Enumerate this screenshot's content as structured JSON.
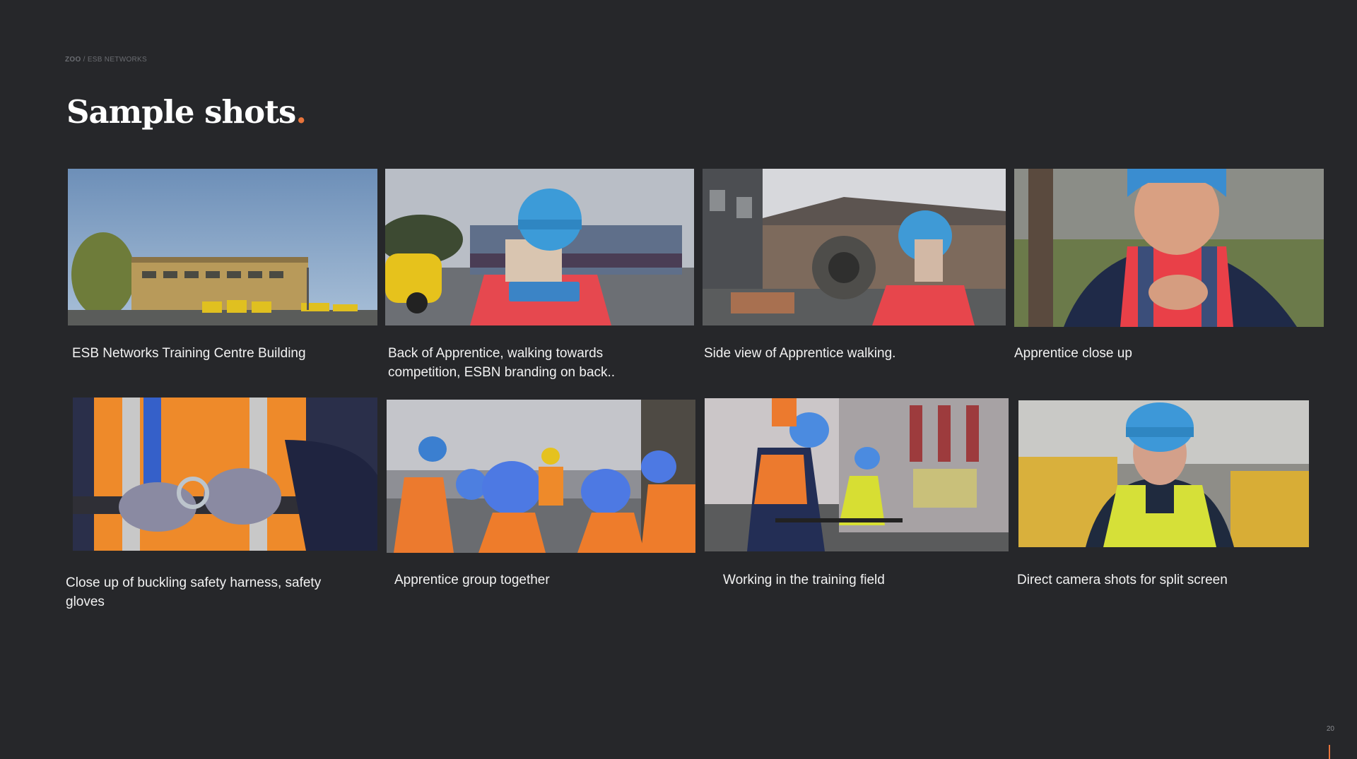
{
  "header": {
    "brand": "ZOO",
    "crumb_rest": " / ESB NETWORKS",
    "title": "Sample shots",
    "title_dot": "."
  },
  "shots": [
    {
      "caption": "ESB Networks Training Centre Building"
    },
    {
      "caption": "Back of Apprentice, walking towards competition, ESBN branding on back.."
    },
    {
      "caption": "Side view of Apprentice walking."
    },
    {
      "caption": "Apprentice close up"
    },
    {
      "caption": "Close up of buckling safety harness, safety gloves"
    },
    {
      "caption": "Apprentice group together"
    },
    {
      "caption": "Working in the training field"
    },
    {
      "caption": "Direct camera shots for split screen"
    }
  ],
  "page_number": "20",
  "colors": {
    "accent": "#e8743b",
    "background": "#26272a"
  }
}
